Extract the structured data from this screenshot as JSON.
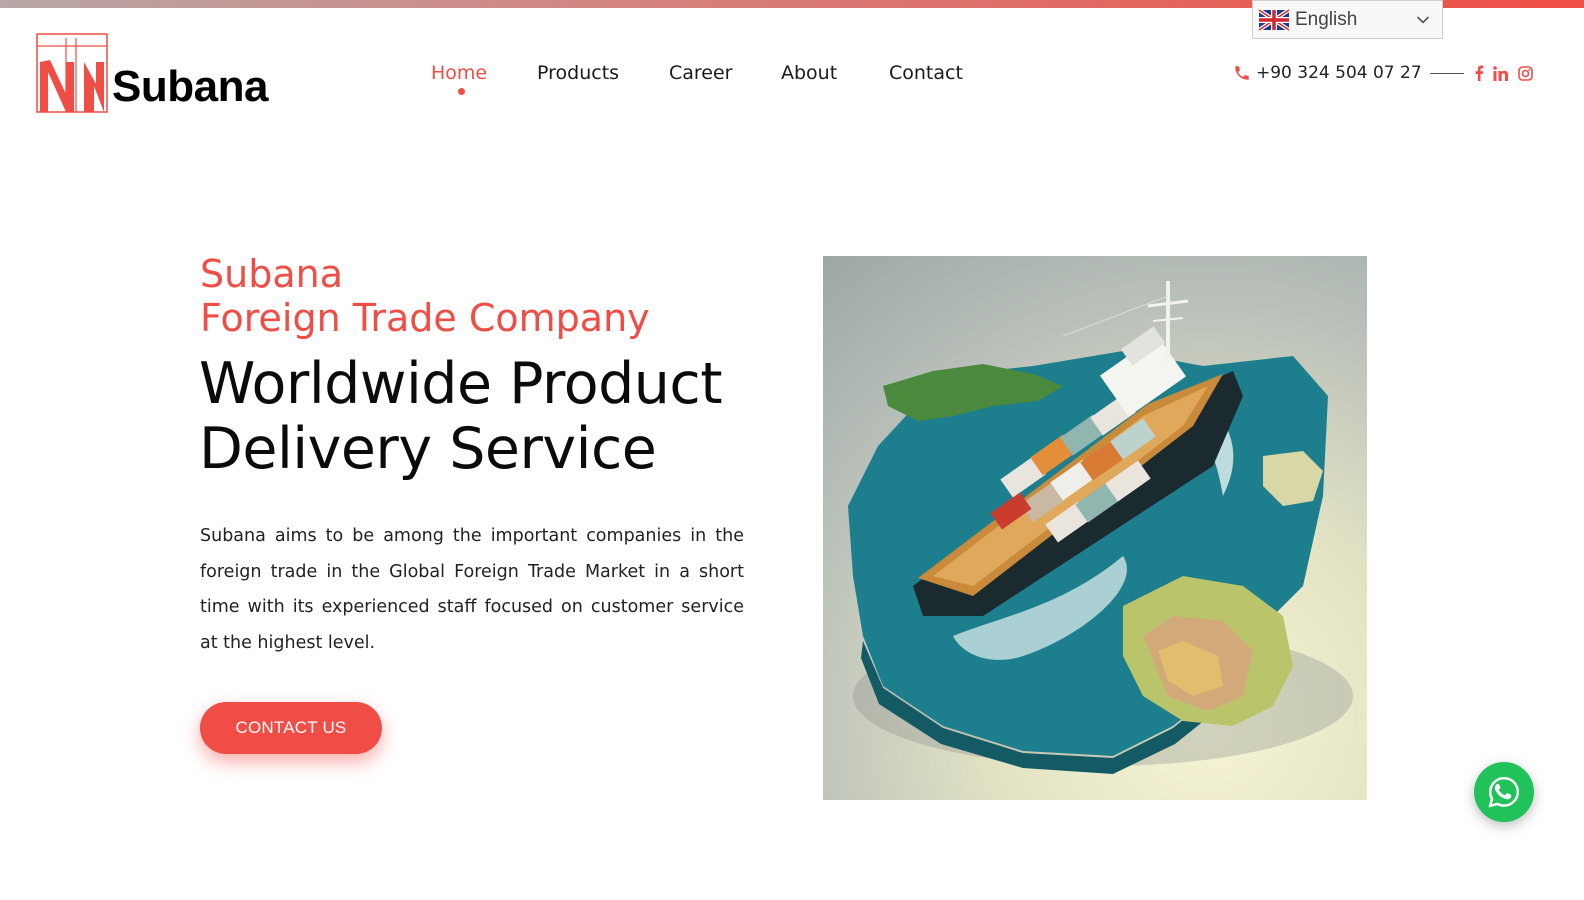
{
  "brand": {
    "name": "Subana",
    "accent_color": "#ef4d45"
  },
  "nav": {
    "items": [
      {
        "label": "Home",
        "active": true
      },
      {
        "label": "Products",
        "active": false
      },
      {
        "label": "Career",
        "active": false
      },
      {
        "label": "About",
        "active": false
      },
      {
        "label": "Contact",
        "active": false
      }
    ]
  },
  "contact_bar": {
    "phone": "+90 324 504 07 27",
    "icons": [
      "phone-icon",
      "facebook-icon",
      "linkedin-icon",
      "instagram-icon"
    ]
  },
  "language_selector": {
    "selected": "English",
    "flag_icon": "uk-flag-icon"
  },
  "hero": {
    "eyebrow_line1": "Subana",
    "eyebrow_line2": "Foreign Trade Company",
    "headline_line1": "Worldwide Product",
    "headline_line2": "Delivery Service",
    "description": "Subana aims to be among the important companies in the foreign trade in the Global Foreign Trade Market in a short time with its experienced staff focused on customer service at the highest level.",
    "cta_label": "CONTACT US"
  },
  "floating": {
    "whatsapp_icon": "whatsapp-icon",
    "whatsapp_color": "#22c25a"
  }
}
